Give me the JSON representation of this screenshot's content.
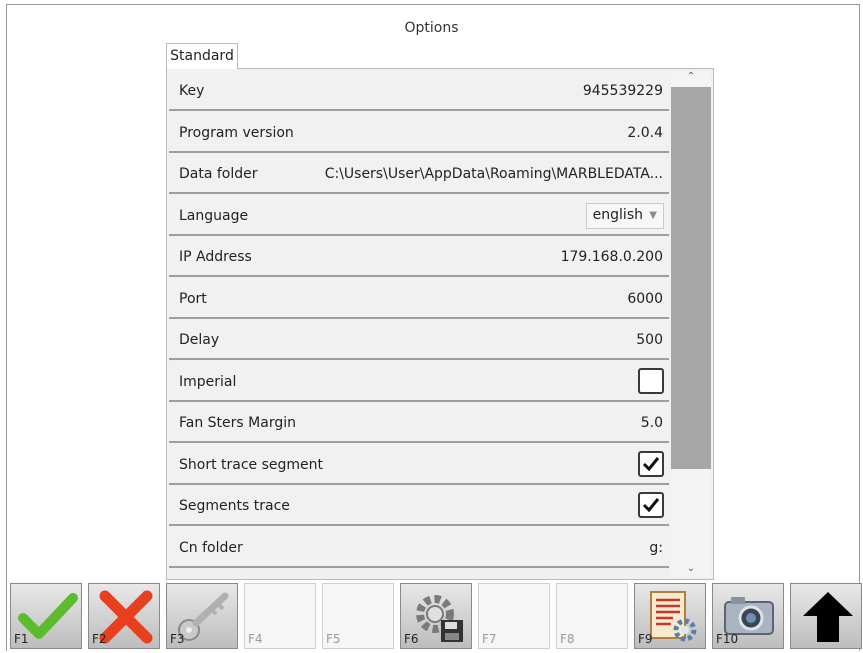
{
  "window": {
    "title": "Options"
  },
  "tabs": [
    {
      "label": "Standard"
    }
  ],
  "settings": [
    {
      "label": "Key",
      "value": "945539229"
    },
    {
      "label": "Program version",
      "value": "2.0.4"
    },
    {
      "label": "Data folder",
      "value": "C:\\Users\\User\\AppData\\Roaming\\MARBLEDATA..."
    },
    {
      "label": "Language",
      "value": "english"
    },
    {
      "label": "IP Address",
      "value": "179.168.0.200"
    },
    {
      "label": "Port",
      "value": "6000"
    },
    {
      "label": "Delay",
      "value": "500"
    },
    {
      "label": "Imperial",
      "checked": false
    },
    {
      "label": "Fan Sters Margin",
      "value": "5.0"
    },
    {
      "label": "Short trace segment",
      "checked": true
    },
    {
      "label": "Segments trace",
      "checked": true
    },
    {
      "label": "Cn folder",
      "value": "g:"
    }
  ],
  "toolbar": {
    "keys": [
      {
        "label": "F1",
        "icon": "green-checkmark-icon"
      },
      {
        "label": "F2",
        "icon": "red-x-icon"
      },
      {
        "label": "F3",
        "icon": "key-icon"
      },
      {
        "label": "F4",
        "icon": ""
      },
      {
        "label": "F5",
        "icon": ""
      },
      {
        "label": "F6",
        "icon": "gear-save-icon"
      },
      {
        "label": "F7",
        "icon": ""
      },
      {
        "label": "F8",
        "icon": ""
      },
      {
        "label": "F9",
        "icon": "document-settings-icon"
      },
      {
        "label": "F10",
        "icon": "camera-icon"
      },
      {
        "label": "",
        "icon": "up-arrow-icon"
      }
    ]
  },
  "colors": {
    "check_green": "#5dbb2e",
    "x_red": "#e8401f",
    "scroll_thumb": "#a6a6a6"
  }
}
